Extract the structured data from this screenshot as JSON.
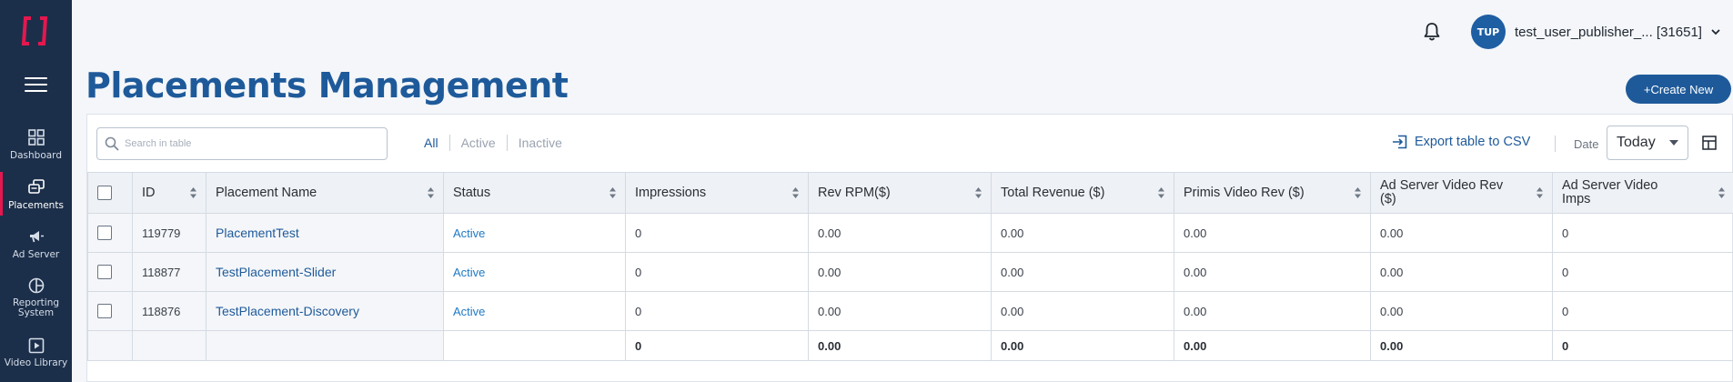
{
  "brand": {
    "accent": "#e5174f",
    "primary": "#1e5a9a",
    "sidebar_bg": "#1c2f4a"
  },
  "sidebar": {
    "items": [
      {
        "label": "Dashboard",
        "icon": "dashboard-icon"
      },
      {
        "label": "Placements",
        "icon": "placements-icon"
      },
      {
        "label": "Ad Server",
        "icon": "megaphone-icon"
      },
      {
        "label": "Reporting System",
        "icon": "pie-chart-icon"
      },
      {
        "label": "Video Library",
        "icon": "video-library-icon"
      }
    ]
  },
  "header": {
    "user_initials": "TUP",
    "user_name": "test_user_publisher_... [31651]"
  },
  "page": {
    "title": "Placements Management",
    "create_label": "+Create New"
  },
  "toolbar": {
    "search_placeholder": "Search in table",
    "filters": [
      "All",
      "Active",
      "Inactive"
    ],
    "export_label": "Export table to CSV",
    "date_label": "Date",
    "date_value": "Today"
  },
  "table": {
    "columns": [
      "ID",
      "Placement Name",
      "Status",
      "Impressions",
      "Rev RPM($)",
      "Total Revenue ($)",
      "Primis Video Rev ($)",
      "Ad Server Video Rev ($)",
      "Ad Server Video Imps"
    ],
    "rows": [
      {
        "id": "119779",
        "name": "PlacementTest",
        "status": "Active",
        "impressions": "0",
        "rev_rpm": "0.00",
        "total_revenue": "0.00",
        "primis_video_rev": "0.00",
        "ad_server_video_rev": "0.00",
        "ad_server_video_imps": "0"
      },
      {
        "id": "118877",
        "name": "TestPlacement-Slider",
        "status": "Active",
        "impressions": "0",
        "rev_rpm": "0.00",
        "total_revenue": "0.00",
        "primis_video_rev": "0.00",
        "ad_server_video_rev": "0.00",
        "ad_server_video_imps": "0"
      },
      {
        "id": "118876",
        "name": "TestPlacement-Discovery",
        "status": "Active",
        "impressions": "0",
        "rev_rpm": "0.00",
        "total_revenue": "0.00",
        "primis_video_rev": "0.00",
        "ad_server_video_rev": "0.00",
        "ad_server_video_imps": "0"
      }
    ],
    "totals": {
      "impressions": "0",
      "rev_rpm": "0.00",
      "total_revenue": "0.00",
      "primis_video_rev": "0.00",
      "ad_server_video_rev": "0.00",
      "ad_server_video_imps": "0"
    }
  }
}
